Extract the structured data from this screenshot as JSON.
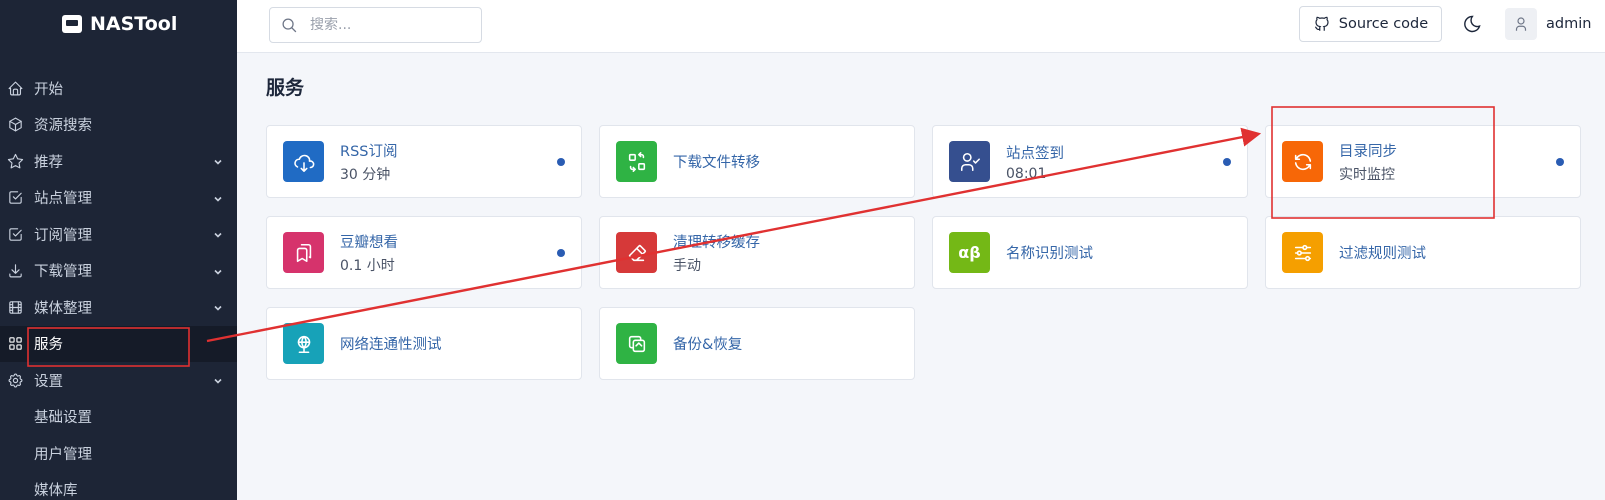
{
  "app": {
    "name": "NASTool"
  },
  "sidebar": {
    "items": [
      {
        "label": "开始",
        "icon": "home-icon",
        "chevron": false,
        "active": false
      },
      {
        "label": "资源搜索",
        "icon": "package-icon",
        "chevron": false,
        "active": false
      },
      {
        "label": "推荐",
        "icon": "star-icon",
        "chevron": true,
        "active": false
      },
      {
        "label": "站点管理",
        "icon": "checkbox-icon",
        "chevron": true,
        "active": false
      },
      {
        "label": "订阅管理",
        "icon": "checkbox-icon",
        "chevron": true,
        "active": false
      },
      {
        "label": "下载管理",
        "icon": "download-icon",
        "chevron": true,
        "active": false
      },
      {
        "label": "媒体整理",
        "icon": "film-icon",
        "chevron": true,
        "active": false
      },
      {
        "label": "服务",
        "icon": "apps-icon",
        "chevron": false,
        "active": true
      },
      {
        "label": "设置",
        "icon": "settings-icon",
        "chevron": true,
        "active": false
      }
    ],
    "subitems": [
      "基础设置",
      "用户管理",
      "媒体库"
    ]
  },
  "header": {
    "search_placeholder": "搜索...",
    "source_label": "Source code",
    "user": "admin"
  },
  "main": {
    "title": "服务",
    "cards": [
      {
        "title": "RSS订阅",
        "sub": "30 分钟",
        "color": "#206bc4",
        "icon": "cloud-download-icon",
        "dot": true
      },
      {
        "title": "下载文件转移",
        "sub": "",
        "color": "#2fb344",
        "icon": "transfer-icon",
        "dot": false
      },
      {
        "title": "站点签到",
        "sub": "08:01",
        "color": "#354f8f",
        "icon": "user-check-icon",
        "dot": true
      },
      {
        "title": "目录同步",
        "sub": "实时监控",
        "color": "#f76707",
        "icon": "refresh-icon",
        "dot": true
      },
      {
        "title": "豆瓣想看",
        "sub": "0.1 小时",
        "color": "#d6336c",
        "icon": "bookmarks-icon",
        "dot": true
      },
      {
        "title": "清理转移缓存",
        "sub": "手动",
        "color": "#d63939",
        "icon": "eraser-icon",
        "dot": false
      },
      {
        "title": "名称识别测试",
        "sub": "",
        "color": "#74b816",
        "icon": "alpha-beta-icon",
        "glyph": "αβ",
        "dot": false
      },
      {
        "title": "过滤规则测试",
        "sub": "",
        "color": "#f59f00",
        "icon": "adjustments-icon",
        "dot": false
      },
      {
        "title": "网络连通性测试",
        "sub": "",
        "color": "#17a2b8",
        "icon": "world-icon",
        "dot": false
      },
      {
        "title": "备份&恢复",
        "sub": "",
        "color": "#2fb344",
        "icon": "copy-icon",
        "dot": false
      }
    ]
  },
  "annotation": {
    "color": "#e03131"
  }
}
